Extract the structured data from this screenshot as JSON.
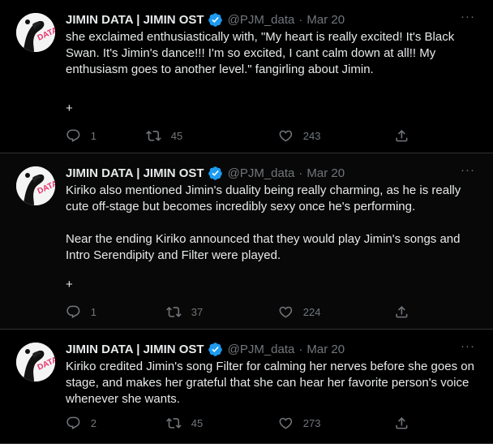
{
  "tweets": [
    {
      "author": "JIMIN DATA | JIMIN OST",
      "handle": "@PJM_data",
      "separator": "·",
      "date": "Mar 20",
      "paragraphs": [
        "she exclaimed enthusiastically with, \"My heart is really excited! It's Black Swan. It's Jimin's dance!!! I'm so excited, I cant calm down at all!! My enthusiasm goes to another level.\" fangirling about Jimin."
      ],
      "thread_marker": "+",
      "replies": "1",
      "retweets": "45",
      "likes": "243"
    },
    {
      "author": "JIMIN DATA | JIMIN OST",
      "handle": "@PJM_data",
      "separator": "·",
      "date": "Mar 20",
      "paragraphs": [
        "Kiriko also mentioned Jimin's duality being really charming, as he is really cute off-stage but becomes incredibly sexy once he's performing.",
        "Near the ending Kiriko announced that they would play Jimin's songs and Intro Serendipity and Filter were played."
      ],
      "thread_marker": "+",
      "replies": "1",
      "retweets": "37",
      "likes": "224"
    },
    {
      "author": "JIMIN DATA | JIMIN OST",
      "handle": "@PJM_data",
      "separator": "·",
      "date": "Mar 20",
      "paragraphs": [
        "Kiriko credited Jimin's song Filter for calming her nerves before she goes on stage, and makes her grateful that she can hear her favorite person's voice whenever she wants."
      ],
      "replies": "2",
      "retweets": "45",
      "likes": "273"
    }
  ],
  "avatar_logo_text": "DATA",
  "more_glyph": "···",
  "icons": {
    "verified": "verified-badge-icon",
    "reply": "reply-icon",
    "retweet": "retweet-icon",
    "like": "heart-icon",
    "share": "share-icon",
    "more": "more-icon"
  },
  "colors": {
    "background": "#000000",
    "text": "#e7e9ea",
    "muted": "#71767b",
    "verified": "#1d9bf0",
    "divider": "#2f3336",
    "logo_pink": "#e8336c"
  }
}
